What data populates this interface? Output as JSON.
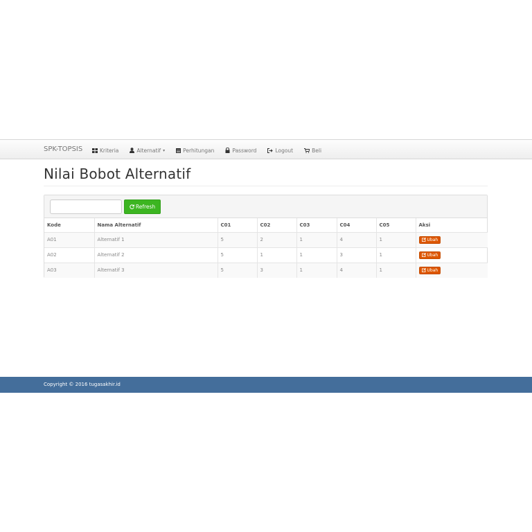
{
  "navbar": {
    "brand": "SPK-TOPSIS",
    "items": [
      {
        "label": "Kriteria",
        "icon": "th-large-icon"
      },
      {
        "label": "Alternatif",
        "icon": "user-icon",
        "dropdown": true
      },
      {
        "label": "Perhitungan",
        "icon": "calendar-icon"
      },
      {
        "label": "Password",
        "icon": "lock-icon"
      },
      {
        "label": "Logout",
        "icon": "log-out-icon"
      },
      {
        "label": "Beli",
        "icon": "shopping-cart-icon"
      }
    ]
  },
  "page": {
    "title": "Nilai Bobot Alternatif"
  },
  "toolbar": {
    "search_value": "",
    "search_placeholder": "",
    "refresh_label": "Refresh"
  },
  "table": {
    "headers": [
      "Kode",
      "Nama Alternatif",
      "C01",
      "C02",
      "C03",
      "C04",
      "C05",
      "Aksi"
    ],
    "rows": [
      {
        "kode": "A01",
        "nama": "Alternatif 1",
        "c01": "5",
        "c02": "2",
        "c03": "1",
        "c04": "4",
        "c05": "1",
        "action": "Ubah"
      },
      {
        "kode": "A02",
        "nama": "Alternatif 2",
        "c01": "5",
        "c02": "1",
        "c03": "1",
        "c04": "3",
        "c05": "1",
        "action": "Ubah"
      },
      {
        "kode": "A03",
        "nama": "Alternatif 3",
        "c01": "5",
        "c02": "3",
        "c03": "1",
        "c04": "4",
        "c05": "1",
        "action": "Ubah"
      }
    ]
  },
  "footer": {
    "copyright": "Copyright © 2016 tugasakhir.id"
  },
  "colors": {
    "success": "#3cb521",
    "warning": "#dd5600",
    "footer_bg": "#446e9b"
  }
}
